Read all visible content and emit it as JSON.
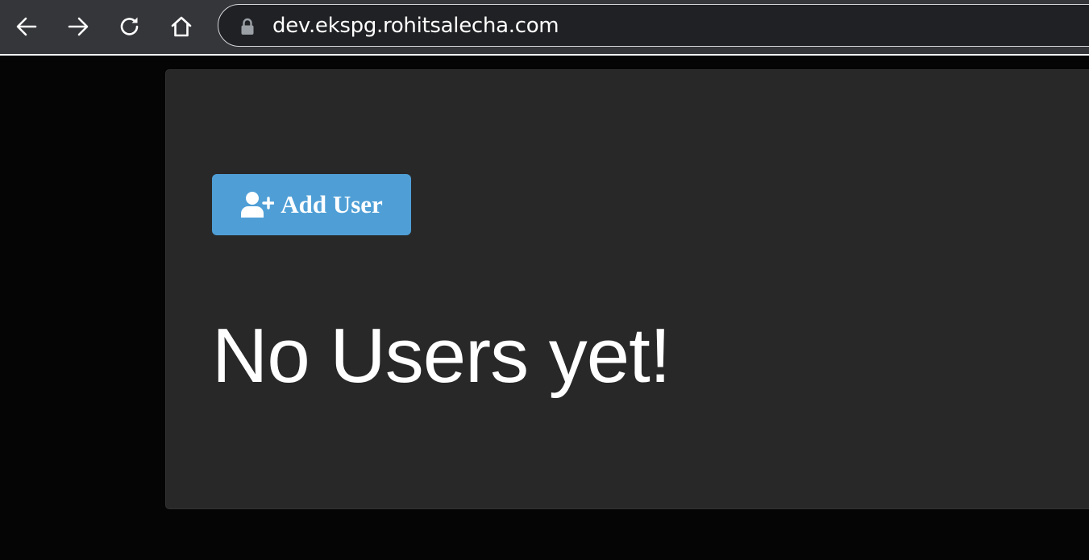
{
  "browser": {
    "url": "dev.ekspg.rohitsalecha.com",
    "icons": {
      "back": "arrow-left-icon",
      "forward": "arrow-right-icon",
      "reload": "reload-icon",
      "home": "home-icon",
      "lock": "lock-icon"
    }
  },
  "page": {
    "add_button_label": "Add User",
    "add_button_icon": "user-plus-icon",
    "empty_message": "No Users yet!"
  },
  "colors": {
    "toolbar": "#35363a",
    "page_background": "#050505",
    "card_background": "#282828",
    "button_primary": "#4f9fd6",
    "text": "#ffffff"
  }
}
